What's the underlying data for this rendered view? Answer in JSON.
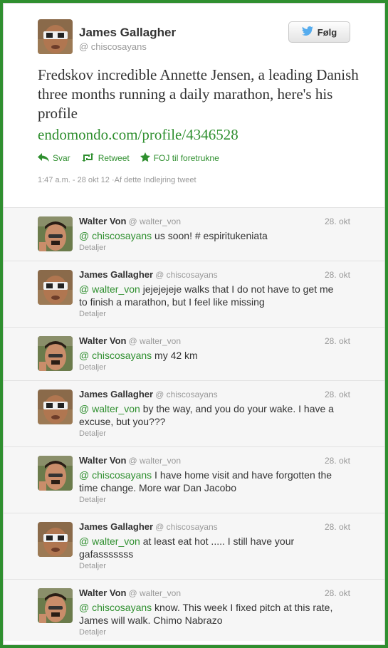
{
  "author": {
    "name": "James Gallagher",
    "handle": "@ chiscosayans"
  },
  "follow_button": {
    "label": "Følg",
    "icon": "twitter-bird-icon"
  },
  "tweet": {
    "text": "Fredskov incredible Annette Jensen, a leading Danish three months running a daily marathon, here's his profile",
    "link": "endomondo.com/profile/4346528"
  },
  "actions": [
    {
      "label": "Svar",
      "icon": "reply-icon"
    },
    {
      "label": "Retweet",
      "icon": "retweet-icon"
    },
    {
      "label": "FOJ til foretrukne",
      "icon": "star-icon"
    }
  ],
  "meta": "1:47 a.m. - 28 okt 12 ·Af dette Indlejring tweet",
  "replies": [
    {
      "name": "Walter Von",
      "handle": "@ walter_von",
      "date": "28. okt",
      "mention": "@ chiscosayans",
      "text": " us soon! # espiritukeniata",
      "details": "Detaljer"
    },
    {
      "name": "James Gallagher",
      "handle": "@ chiscosayans",
      "date": "28. okt",
      "mention": "@ walter_von",
      "text": " jejejejeje walks that I do not have to get me to finish a marathon, but I feel like missing",
      "details": "Detaljer"
    },
    {
      "name": "Walter Von",
      "handle": "@ walter_von",
      "date": "28. okt",
      "mention": "@ chiscosayans",
      "text": " my 42 km",
      "details": "Detaljer"
    },
    {
      "name": "James Gallagher",
      "handle": "@ chiscosayans",
      "date": "28. okt",
      "mention": "@ walter_von",
      "text": " by the way, and you do your wake. I have a excuse, but you???",
      "details": "Detaljer"
    },
    {
      "name": "Walter Von",
      "handle": "@ walter_von",
      "date": "28. okt",
      "mention": "@ chiscosayans",
      "text": " I have home visit and have forgotten the time change. More war Dan Jacobo",
      "details": "Detaljer"
    },
    {
      "name": "James Gallagher",
      "handle": "@ chiscosayans",
      "date": "28. okt",
      "mention": "@ walter_von",
      "text": " at least eat hot ..... I still have your gafasssssss",
      "details": "Detaljer"
    },
    {
      "name": "Walter Von",
      "handle": "@ walter_von",
      "date": "28. okt",
      "mention": "@ chiscosayans",
      "text": " know. This week I fixed pitch at this rate, James will walk. Chimo Nabrazo",
      "details": "Detaljer"
    }
  ]
}
